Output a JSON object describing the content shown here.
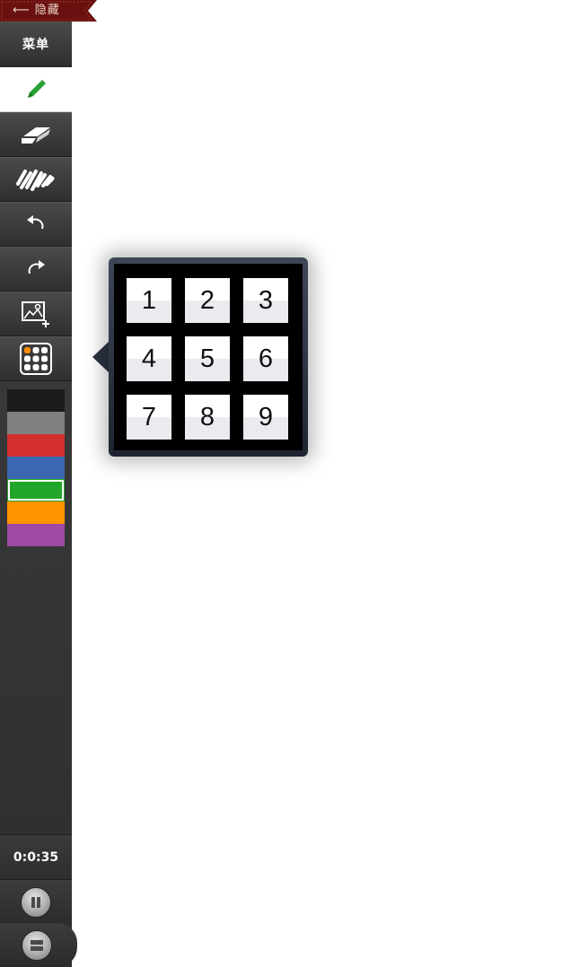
{
  "hide_tab": {
    "label": "⟵ 隐藏"
  },
  "sidebar": {
    "menu_label": "菜单",
    "tools": [
      {
        "name": "pen",
        "active": true
      },
      {
        "name": "eraser",
        "active": false
      },
      {
        "name": "scribble-clear",
        "active": false
      },
      {
        "name": "undo",
        "active": false
      },
      {
        "name": "redo",
        "active": false
      },
      {
        "name": "add-image",
        "active": false
      },
      {
        "name": "grid",
        "active": false
      }
    ],
    "colors": [
      "#1b1b1b",
      "#808080",
      "#d32f2f",
      "#3a67b0",
      "#22a62a",
      "#ff9400",
      "#a04aa3"
    ],
    "selected_color": "#22a62a",
    "timer": "0:0:35",
    "controls": [
      "pause",
      "stop"
    ]
  },
  "grid_popup": {
    "cells": [
      "1",
      "2",
      "3",
      "4",
      "5",
      "6",
      "7",
      "8",
      "9"
    ]
  }
}
